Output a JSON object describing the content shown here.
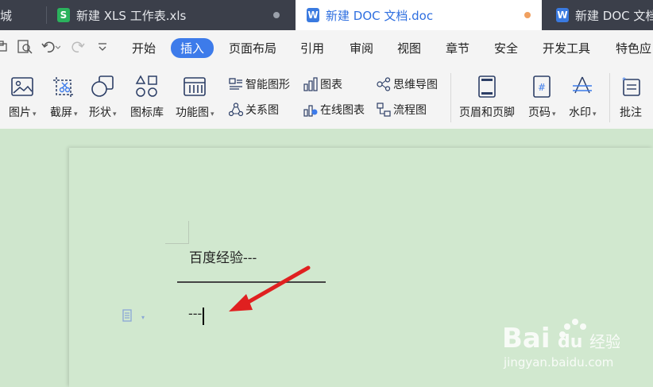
{
  "tabs": [
    {
      "label": "城",
      "icon": "",
      "icon_color": ""
    },
    {
      "label": "新建 XLS 工作表.xls",
      "icon": "S",
      "icon_color": "#2bb25d"
    },
    {
      "label": "新建 DOC 文档.doc",
      "icon": "W",
      "icon_color": "#3a7ae0",
      "active": true
    },
    {
      "label": "新建 DOC 文档",
      "icon": "W",
      "icon_color": "#3a7ae0"
    }
  ],
  "menu": {
    "items": [
      "开始",
      "插入",
      "页面布局",
      "引用",
      "审阅",
      "视图",
      "章节",
      "安全",
      "开发工具",
      "特色应"
    ],
    "active": "插入"
  },
  "ribbon": {
    "big_buttons": [
      {
        "label": "图片",
        "icon": "picture-icon"
      },
      {
        "label": "截屏",
        "icon": "screenshot-icon"
      },
      {
        "label": "形状",
        "icon": "shapes-icon"
      },
      {
        "label": "图标库",
        "icon": "icon-library-icon"
      },
      {
        "label": "功能图",
        "icon": "function-chart-icon"
      }
    ],
    "small_buttons": [
      {
        "label": "智能图形",
        "icon": "smart-graphic-icon"
      },
      {
        "label": "关系图",
        "icon": "relation-chart-icon"
      },
      {
        "label": "图表",
        "icon": "chart-icon"
      },
      {
        "label": "在线图表",
        "icon": "online-chart-icon"
      },
      {
        "label": "思维导图",
        "icon": "mindmap-icon"
      },
      {
        "label": "流程图",
        "icon": "flowchart-icon"
      }
    ],
    "right_buttons": [
      {
        "label": "页眉和页脚",
        "icon": "header-footer-icon"
      },
      {
        "label": "页码",
        "icon": "page-number-icon"
      },
      {
        "label": "水印",
        "icon": "watermark-icon"
      },
      {
        "label": "批注",
        "icon": "comment-icon"
      }
    ]
  },
  "document": {
    "line1": "百度经验---",
    "line2": "---"
  },
  "colors": {
    "accent": "#3d7bea",
    "arrow": "#e02020",
    "page": "#d1e8cf"
  }
}
